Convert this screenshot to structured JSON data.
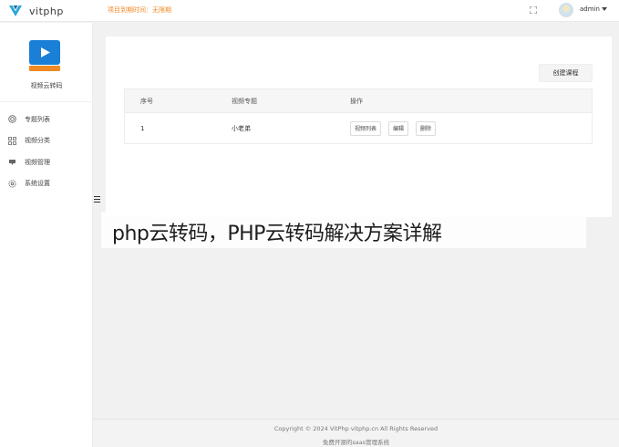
{
  "header": {
    "brand": "vitphp",
    "notice": "项目到期时间：无限期",
    "user": "admin",
    "brand_color": "#2aa6d9",
    "notice_color": "#f08a24"
  },
  "sidebar": {
    "app_label": "视频云转码",
    "app_icon": "play-video-icon",
    "items": [
      {
        "label": "专题列表",
        "icon": "layers-icon"
      },
      {
        "label": "视频分类",
        "icon": "grid-icon"
      },
      {
        "label": "视频管理",
        "icon": "video-manage-icon"
      },
      {
        "label": "系统设置",
        "icon": "gear-icon"
      }
    ]
  },
  "main": {
    "create_button": "创建课程",
    "table": {
      "columns": [
        "序号",
        "视频专题",
        "操作"
      ],
      "rows": [
        {
          "index": "1",
          "topic": "小老弟",
          "actions": [
            "视频列表",
            "编辑",
            "删除"
          ]
        }
      ]
    }
  },
  "overlay": {
    "title": "php云转码，PHP云转码解决方案详解"
  },
  "footer": {
    "copyright": "Copyright © 2024 VitPhp vitphp.cn All Rights Reserved",
    "tagline": "免费开源的saas管理系统"
  }
}
